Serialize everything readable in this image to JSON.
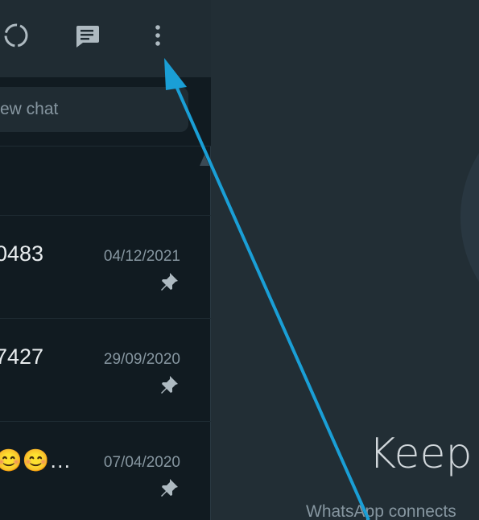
{
  "header": {
    "icons": {
      "status": "status-icon",
      "new_chat": "new-chat-icon",
      "menu": "menu-icon"
    }
  },
  "search": {
    "placeholder": "ew chat"
  },
  "chats": [
    {
      "name": "0483",
      "date": "04/12/2021",
      "pinned": true
    },
    {
      "name": "7427",
      "date": "29/09/2020",
      "pinned": true
    },
    {
      "name": "😊😊…",
      "date": "07/04/2020",
      "pinned": true
    }
  ],
  "main": {
    "title": "Keep y",
    "subtitle": "WhatsApp connects"
  },
  "colors": {
    "sidebar_bg": "#111b21",
    "header_bg": "#202c33",
    "main_bg": "#222e35",
    "annotation_arrow": "#1a9fd6"
  }
}
